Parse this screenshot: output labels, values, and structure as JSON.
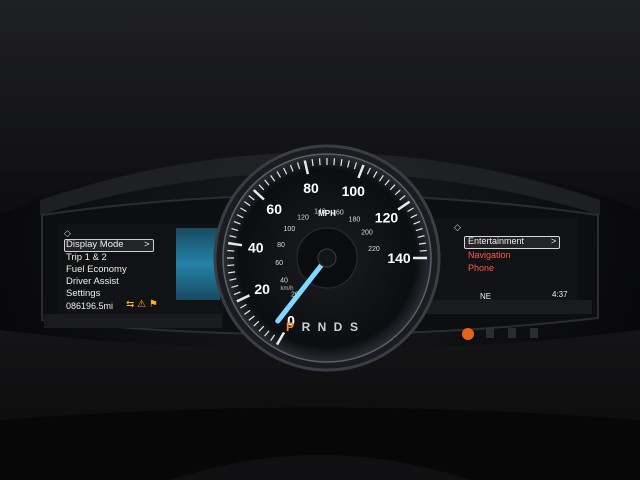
{
  "left_display": {
    "nav_icon": "arrows-icon",
    "menu": [
      {
        "label": "Display Mode",
        "selected": true,
        "chevron": ">"
      },
      {
        "label": "Trip 1 & 2",
        "selected": false
      },
      {
        "label": "Fuel Economy",
        "selected": false
      },
      {
        "label": "Driver Assist",
        "selected": false
      },
      {
        "label": "Settings",
        "selected": false
      }
    ],
    "odometer": "086196.5mi"
  },
  "speedometer": {
    "unit": "MPH",
    "outer_ticks": [
      "0",
      "20",
      "40",
      "60",
      "80",
      "100",
      "120",
      "140"
    ],
    "inner_ticks": [
      "20",
      "40",
      "60",
      "80",
      "100",
      "120",
      "140",
      "160",
      "180",
      "200",
      "220"
    ],
    "inner_unit": "km/h",
    "speed_mph": 0
  },
  "gear_selector": {
    "gears": [
      "P",
      "R",
      "N",
      "D",
      "S"
    ],
    "active": "P"
  },
  "right_display": {
    "nav_icon": "arrows-icon",
    "menu": [
      {
        "label": "Entertainment",
        "selected": true,
        "chevron": ">"
      },
      {
        "label": "Navigation",
        "selected": false
      },
      {
        "label": "Phone",
        "selected": false
      }
    ],
    "compass": "NE",
    "time": "4:37"
  },
  "colors": {
    "needle": "#7fd8ff",
    "accent_red": "#ff5a3c",
    "amber": "#ffb020",
    "blue_gauge": "#2aa8d8"
  }
}
